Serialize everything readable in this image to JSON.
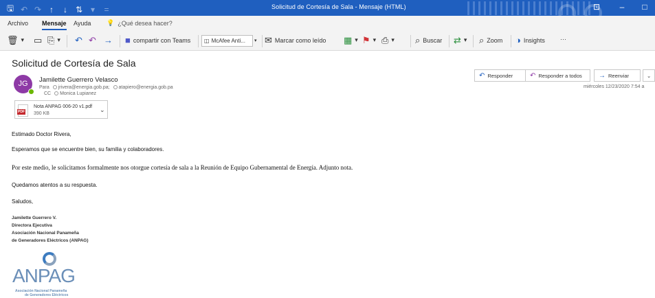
{
  "window": {
    "title": "Solicitud de Cortesía de Sala  -  Mensaje (HTML)",
    "quick_access": [
      "🖫",
      "↶",
      "↷",
      "↑",
      "↓",
      "⇅",
      "▾",
      "="
    ],
    "controls": [
      "⊡",
      "–",
      "□"
    ]
  },
  "ribbon": {
    "tabs": [
      "Archivo",
      "Mensaje",
      "Ayuda"
    ],
    "active_tab": "Mensaje",
    "tell_me": "¿Qué desea hacer?"
  },
  "toolbar": {
    "teams_label": "compartir con Teams",
    "mcafee_label": "McAfee Anti...",
    "mark_unread_label": "Marcar como leído",
    "search_label": "Buscar",
    "zoom_label": "Zoom",
    "insights_label": "Insights",
    "more_label": "···"
  },
  "message": {
    "subject": "Solicitud de Cortesía de Sala",
    "avatar_initials": "JG",
    "sender": "Jamilette Guerrero Velasco",
    "to_label": "Para",
    "to_1": "jrivera@energia.gob.pa;",
    "to_2": "atapiero@energia.gob.pa",
    "cc_label": "CC",
    "cc_1": "Monica Lupianez",
    "datetime": "miércoles 12/23/2020 7:54 a",
    "attachment": {
      "name": "Nota ANPAG 006-20 v1.pdf",
      "size": "390 KB",
      "badge": "PDF"
    },
    "actions": {
      "reply": "Responder",
      "reply_all": "Responder a todos",
      "forward": "Reenviar"
    }
  },
  "body": {
    "greeting": "Estimado Doctor Rivera,",
    "line1": "Esperamos que se encuentre bien, su familia y colaboradores.",
    "line2": "Por este medio, le solicitamos formalmente nos otorgue cortesía de sala a la Reunión de Equipo Gubernamental de Energía. Adjunto nota.",
    "line3": "Quedamos atentos a su respuesta.",
    "closing": "Saludos,",
    "signature": [
      "Jamilette Guerrero V.",
      "Directora Ejecutiva",
      "Asociación Nacional Panameña",
      "de Generadores Eléctricos (ANPAG)"
    ],
    "logo": {
      "word": "ANPAG",
      "sub1": "Asociación Nacional Panameña",
      "sub2": "de Generadores Eléctricos"
    }
  },
  "colors": {
    "titlebar": "#1f5fbf",
    "avatar": "#8e3aa6",
    "presence": "#6bb700",
    "logo": "#6b8fb8"
  }
}
